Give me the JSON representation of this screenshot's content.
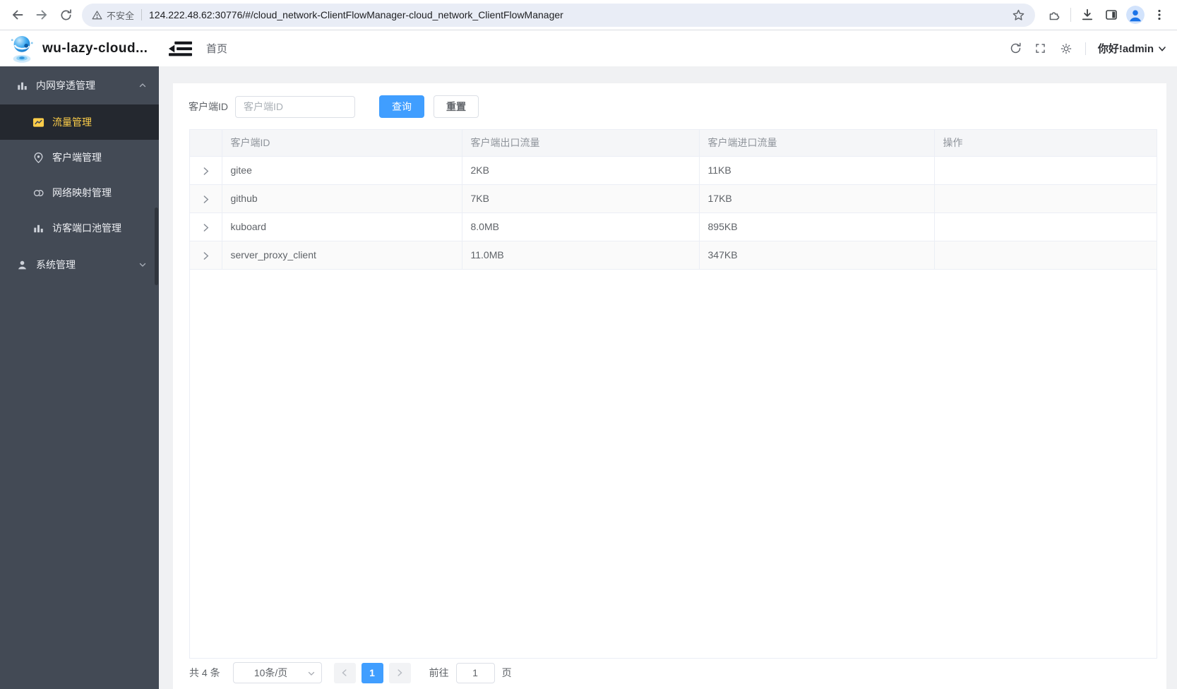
{
  "browser": {
    "security_label": "不安全",
    "url": "124.222.48.62:30776/#/cloud_network-ClientFlowManager-cloud_network_ClientFlowManager"
  },
  "header": {
    "app_title": "wu-lazy-cloud...",
    "breadcrumb": "首页",
    "greeting": "你好!admin"
  },
  "sidebar": {
    "groups": [
      {
        "label": "内网穿透管理",
        "expanded": true,
        "items": [
          {
            "label": "流量管理",
            "active": true
          },
          {
            "label": "客户端管理",
            "active": false
          },
          {
            "label": "网络映射管理",
            "active": false
          },
          {
            "label": "访客端口池管理",
            "active": false
          }
        ]
      },
      {
        "label": "系统管理",
        "expanded": false,
        "items": []
      }
    ]
  },
  "filter": {
    "label": "客户端ID",
    "placeholder": "客户端ID",
    "value": "",
    "query_label": "查询",
    "reset_label": "重置"
  },
  "table": {
    "columns": [
      "客户端ID",
      "客户端出口流量",
      "客户端进口流量",
      "操作"
    ],
    "rows": [
      {
        "id": "gitee",
        "out": "2KB",
        "in": "11KB"
      },
      {
        "id": "github",
        "out": "7KB",
        "in": "17KB"
      },
      {
        "id": "kuboard",
        "out": "8.0MB",
        "in": "895KB"
      },
      {
        "id": "server_proxy_client",
        "out": "11.0MB",
        "in": "347KB"
      }
    ]
  },
  "pagination": {
    "total_label": "共 4 条",
    "page_size_label": "10条/页",
    "current_page": "1",
    "goto_label": "前往",
    "goto_value": "1",
    "unit_label": "页"
  },
  "colors": {
    "accent_blue": "#409eff",
    "sidebar_bg": "#434a55",
    "sidebar_active_bg": "#24282f",
    "sidebar_active_text": "#fdce4a",
    "table_border": "#ebeef5",
    "header_text": "#909399"
  },
  "icons": {
    "toolbar": [
      "back-icon",
      "forward-icon",
      "reload-icon",
      "warning-icon",
      "star-icon",
      "extensions-icon",
      "download-icon",
      "side-panel-icon",
      "profile-icon",
      "kebab-menu-icon"
    ],
    "app_header": [
      "robot-logo-icon",
      "fold-menu-icon",
      "refresh-icon",
      "fullscreen-icon",
      "theme-sun-icon",
      "chevron-down-icon"
    ],
    "sidebar": [
      "bar-chart-icon",
      "trend-chart-icon",
      "location-pin-icon",
      "link-icon",
      "bar-chart-icon",
      "user-icon"
    ],
    "table": [
      "chevron-right-icon"
    ]
  }
}
